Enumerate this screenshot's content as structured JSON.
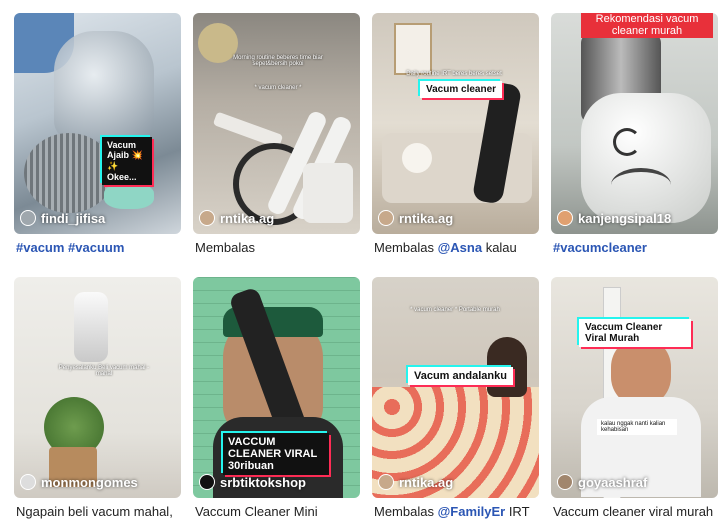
{
  "videos": [
    {
      "user": "findi_jifisa",
      "caption_tag": "#vacum #vacuum",
      "caption_text": "",
      "caption_tag2": "",
      "overlay": "Vacum Ajaib 💥✨ Okee..."
    },
    {
      "user": "rntika.ag",
      "caption_text": "Membalas",
      "caption_tag": "",
      "caption_tag2": "",
      "overlay": "Morning routine beberes time biar sepet&bersih pokoi",
      "overlay2": "* vacum cleaner *"
    },
    {
      "user": "rntika.ag",
      "caption_text": "Membalas",
      "caption_tag": "@Asna",
      "caption_tag2": "kalau",
      "overlay": "Vacum cleaner",
      "overlay2": "Daily routine IRT beres beres setset"
    },
    {
      "user": "kanjengsipal18",
      "caption_text": "",
      "caption_tag": "#vacumcleaner",
      "caption_tag2": "",
      "overlay": "Rekomendasi vacum cleaner murah"
    },
    {
      "user": "monmongomes",
      "caption_text": "Ngapain beli vacum mahal,",
      "caption_tag": "",
      "caption_tag2": "",
      "overlay": "Penyesalanku Beli vacum mahal - mahal"
    },
    {
      "user": "srbtiktokshop",
      "caption_text": "Vaccum Cleaner Mini",
      "caption_tag": "",
      "caption_tag2": "",
      "overlay": "VACCUM CLEANER VIRAL 30ribuan"
    },
    {
      "user": "rntika.ag",
      "caption_text": "Membalas",
      "caption_tag": "@FamilyEr",
      "caption_tag2": "IRT",
      "overlay": "Vacum andalanku",
      "overlay2": "* vacum cleaner * Portable murah"
    },
    {
      "user": "goyaashraf",
      "caption_text": "Vaccum cleaner viral murah",
      "caption_tag": "",
      "caption_tag2": "",
      "overlay": "Vaccum Cleaner Viral Murah",
      "overlay2": "kalau nggak nanti kalian kehabisan"
    }
  ],
  "colors": {
    "hashtag": "#2b56b4",
    "caption": "#222222"
  }
}
